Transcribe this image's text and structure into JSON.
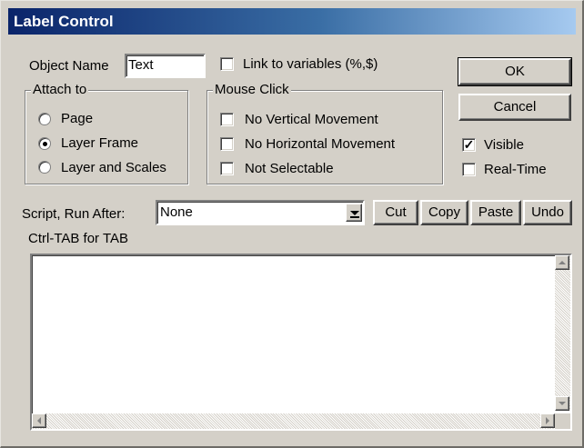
{
  "window": {
    "title": "Label Control"
  },
  "object_name": {
    "label": "Object Name",
    "value": "Text"
  },
  "link_variables": {
    "label": "Link to variables (%,$)",
    "checked": false
  },
  "attach_to": {
    "legend": "Attach to",
    "options": [
      {
        "label": "Page",
        "selected": false
      },
      {
        "label": "Layer Frame",
        "selected": true
      },
      {
        "label": "Layer and Scales",
        "selected": false
      }
    ]
  },
  "mouse_click": {
    "legend": "Mouse Click",
    "options": [
      {
        "label": "No Vertical Movement",
        "checked": false
      },
      {
        "label": "No Horizontal Movement",
        "checked": false
      },
      {
        "label": "Not Selectable",
        "checked": false
      }
    ]
  },
  "buttons": {
    "ok": "OK",
    "cancel": "Cancel"
  },
  "visible": {
    "label": "Visible",
    "checked": true
  },
  "realtime": {
    "label": "Real-Time",
    "checked": false
  },
  "script": {
    "label": "Script, Run After:",
    "selected": "None",
    "hint": "Ctrl-TAB for TAB",
    "content": ""
  },
  "edit_buttons": {
    "cut": "Cut",
    "copy": "Copy",
    "paste": "Paste",
    "undo": "Undo"
  },
  "icons": {
    "dropdown": "chevron-down-icon",
    "scroll_up": "arrow-up-icon",
    "scroll_down": "arrow-down-icon",
    "scroll_left": "arrow-left-icon",
    "scroll_right": "arrow-right-icon"
  },
  "colors": {
    "title_start": "#0a246a",
    "title_end": "#a6caf0",
    "face": "#d4d0c8"
  }
}
